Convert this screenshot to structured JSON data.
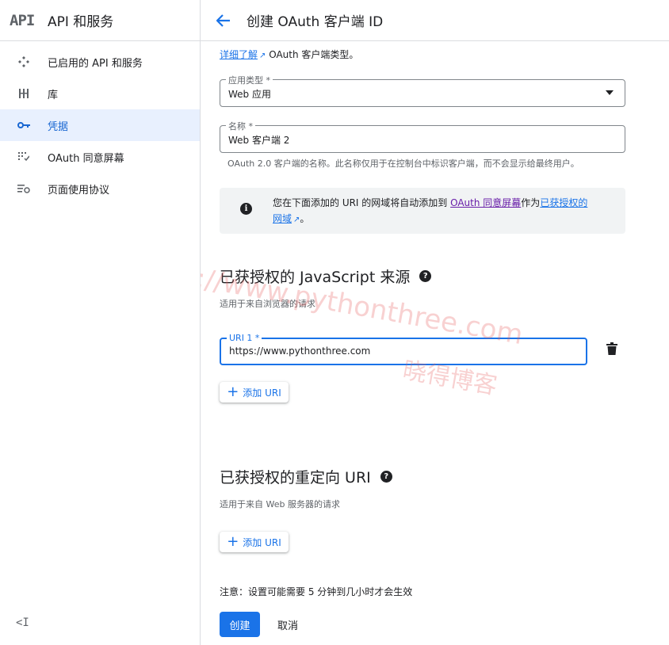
{
  "sidebar": {
    "logo": "API",
    "title": "API 和服务",
    "items": [
      {
        "label": "已启用的 API 和服务",
        "icon": "diamond-icon"
      },
      {
        "label": "库",
        "icon": "library-icon"
      },
      {
        "label": "凭据",
        "icon": "key-icon",
        "active": true
      },
      {
        "label": "OAuth 同意屏幕",
        "icon": "consent-icon"
      },
      {
        "label": "页面使用协议",
        "icon": "settings-list-icon"
      }
    ],
    "collapse": "<I"
  },
  "header": {
    "title": "创建 OAuth 客户端 ID"
  },
  "intro": {
    "link": "详细了解",
    "text": " OAuth 客户端类型。"
  },
  "form": {
    "app_type": {
      "label": "应用类型 *",
      "value": "Web 应用"
    },
    "name": {
      "label": "名称 *",
      "value": "Web 客户端 2",
      "hint": "OAuth 2.0 客户端的名称。此名称仅用于在控制台中标识客户端，而不会显示给最终用户。"
    }
  },
  "info": {
    "text1": "您在下面添加的 URI 的网域将自动添加到 ",
    "link1": "OAuth 同意屏幕",
    "text2": "作为",
    "link2": "已获授权的",
    "link3": "网域",
    "text3": "。"
  },
  "js_origins": {
    "title": "已获授权的 JavaScript 来源",
    "subtitle": "适用于来自浏览器的请求",
    "uri_label": "URI 1 *",
    "uri_value": "https://www.pythonthree.com",
    "add_label": "添加 URI"
  },
  "redirect": {
    "title": "已获授权的重定向 URI",
    "subtitle": "适用于来自 Web 服务器的请求",
    "add_label": "添加 URI"
  },
  "note": "注意：设置可能需要 5 分钟到几小时才会生效",
  "actions": {
    "create": "创建",
    "cancel": "取消"
  },
  "watermark": {
    "line1": "https://www.pythonthree.com",
    "line2": "晓得博客"
  },
  "colors": {
    "accent": "#1a73e8",
    "active_bg": "#e8f0fe"
  }
}
